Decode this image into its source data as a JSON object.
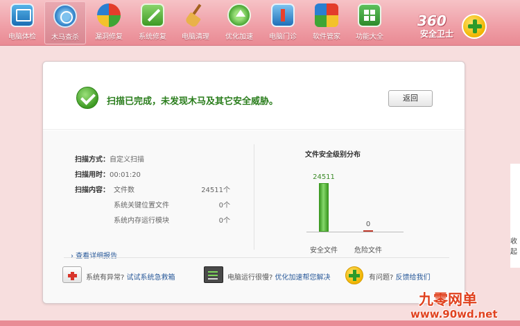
{
  "toolbar": {
    "items": [
      {
        "label": "电脑体检",
        "icon": "monitor-icon"
      },
      {
        "label": "木马查杀",
        "icon": "shield-icon",
        "active": true
      },
      {
        "label": "漏洞修复",
        "icon": "patch-ball-icon"
      },
      {
        "label": "系统修复",
        "icon": "tools-icon"
      },
      {
        "label": "电脑清理",
        "icon": "broom-icon"
      },
      {
        "label": "优化加速",
        "icon": "speed-up-icon"
      },
      {
        "label": "电脑门诊",
        "icon": "doctor-icon"
      },
      {
        "label": "软件管家",
        "icon": "software-manager-icon"
      },
      {
        "label": "功能大全",
        "icon": "apps-icon"
      }
    ],
    "logo": {
      "brand": "360",
      "subtitle": "安全卫士"
    }
  },
  "result": {
    "message": "扫描已完成，未发现木马及其它安全威胁。",
    "back_label": "返回"
  },
  "scan_info": {
    "method_label": "扫描方式：",
    "method_value": "自定义扫描",
    "duration_label": "扫描用时：",
    "duration_value": "00:01:20",
    "content_label": "扫描内容：",
    "content_items": [
      {
        "name": "文件数",
        "count": "24511个"
      },
      {
        "name": "系统关键位置文件",
        "count": "0个"
      },
      {
        "name": "系统内存运行模块",
        "count": "0个"
      }
    ],
    "detail_link": "› 查看详细报告"
  },
  "chart_data": {
    "type": "bar",
    "title": "文件安全级别分布",
    "categories": [
      "安全文件",
      "危险文件"
    ],
    "values": [
      24511,
      0
    ],
    "colors": [
      "#3d9a23",
      "#c0392b"
    ]
  },
  "footer": {
    "items": [
      {
        "text": "系统有异常? ",
        "link": "试试系统急救箱",
        "icon": "first-aid-kit-icon"
      },
      {
        "text": "电脑运行很慢? ",
        "link": "优化加速帮您解决",
        "icon": "terminal-icon"
      },
      {
        "text": "有问题? ",
        "link": "反馈给我们",
        "icon": "plus-icon"
      }
    ]
  },
  "side_text": "收起",
  "watermark": {
    "main": "九零网单",
    "url": "www.90wd.net"
  }
}
